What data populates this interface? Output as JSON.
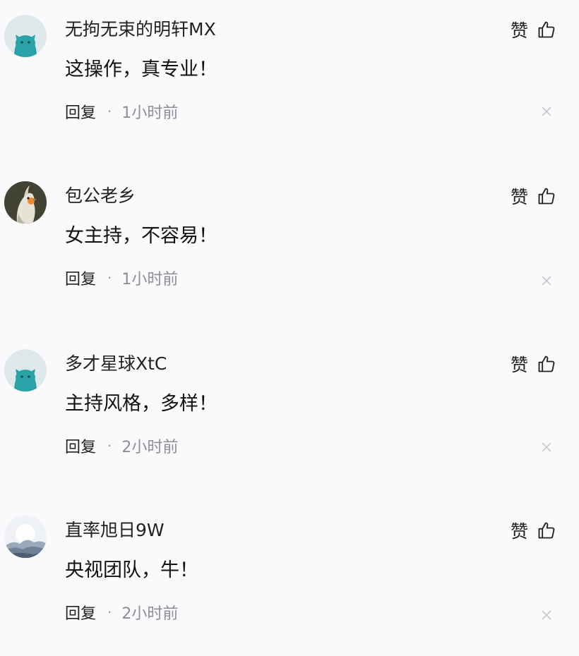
{
  "comments": [
    {
      "avatar": "teal-cat-avatar",
      "username": "无拘无束的明轩MX",
      "text": "这操作，真专业！",
      "like_label": "赞",
      "reply_label": "回复",
      "separator": "·",
      "time": "1小时前"
    },
    {
      "avatar": "cockatiel-bird-avatar",
      "username": "包公老乡",
      "text": "女主持，不容易！",
      "like_label": "赞",
      "reply_label": "回复",
      "separator": "·",
      "time": "1小时前"
    },
    {
      "avatar": "teal-cat-avatar",
      "username": "多才星球XtC",
      "text": "主持风格，多样！",
      "like_label": "赞",
      "reply_label": "回复",
      "separator": "·",
      "time": "2小时前"
    },
    {
      "avatar": "landscape-mountain-avatar",
      "username": "直率旭日9W",
      "text": "央视团队，牛！",
      "like_label": "赞",
      "reply_label": "回复",
      "separator": "·",
      "time": "2小时前"
    }
  ],
  "colors": {
    "background": "#fafafd",
    "text_primary": "#222222",
    "text_secondary": "#8d8d93",
    "avatar_teal": "#2aa3a8",
    "close_icon": "#c8c8cc"
  },
  "icons": [
    "thumbs-up-icon",
    "close-icon"
  ]
}
